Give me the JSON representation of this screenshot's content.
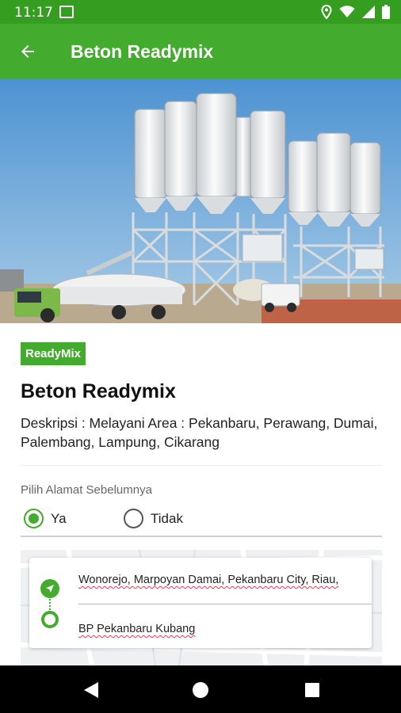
{
  "status_bar": {
    "time": "11:17",
    "icons": [
      "image-icon",
      "location-icon",
      "wifi-icon",
      "signal-icon",
      "battery-icon"
    ]
  },
  "app_bar": {
    "back_icon": "arrow-left-icon",
    "title": "Beton Readymix"
  },
  "hero": {
    "image": "concrete-batching-plant-photo"
  },
  "product": {
    "badge": "ReadyMix",
    "title": "Beton Readymix",
    "description": "Deskripsi : Melayani Area : Pekanbaru, Perawang, Dumai, Palembang, Lampung, Cikarang"
  },
  "address_choice": {
    "label": "Pilih Alamat Sebelumnya",
    "options": [
      {
        "label": "Ya",
        "selected": true
      },
      {
        "label": "Tidak",
        "selected": false
      }
    ]
  },
  "route": {
    "origin": "Wonorejo, Marpoyan Damai, Pekanbaru City, Riau,",
    "destination": "BP Pekanbaru Kubang"
  },
  "nav_bar": {
    "icons": [
      "back-triangle-icon",
      "home-circle-icon",
      "recents-square-icon"
    ]
  },
  "colors": {
    "primary": "#43ab2e",
    "status_bar": "#359e20",
    "spell_underline": "#e0414d"
  }
}
